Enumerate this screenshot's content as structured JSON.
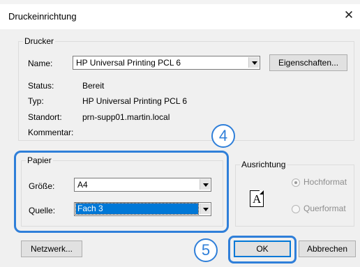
{
  "window": {
    "title": "Druckeinrichtung",
    "close_symbol": "✕"
  },
  "drucker": {
    "legend": "Drucker",
    "name_label": "Name:",
    "name_value": "HP Universal Printing PCL 6",
    "eigenschaften_button": "Eigenschaften...",
    "status_label": "Status:",
    "status_value": "Bereit",
    "typ_label": "Typ:",
    "typ_value": "HP Universal Printing PCL 6",
    "standort_label": "Standort:",
    "standort_value": "prn-supp01.martin.local",
    "kommentar_label": "Kommentar:"
  },
  "papier": {
    "legend": "Papier",
    "groesse_label": "Größe:",
    "groesse_value": "A4",
    "quelle_label": "Quelle:",
    "quelle_value": "Fach 3"
  },
  "ausrichtung": {
    "legend": "Ausrichtung",
    "hochformat": "Hochformat",
    "querformat": "Querformat",
    "selected": "Hochformat",
    "page_glyph": "A"
  },
  "buttons": {
    "netzwerk": "Netzwerk...",
    "ok": "OK",
    "abbrechen": "Abbrechen"
  },
  "annotations": {
    "step4": "4",
    "step5": "5",
    "accent_color": "#2f7fd9"
  }
}
